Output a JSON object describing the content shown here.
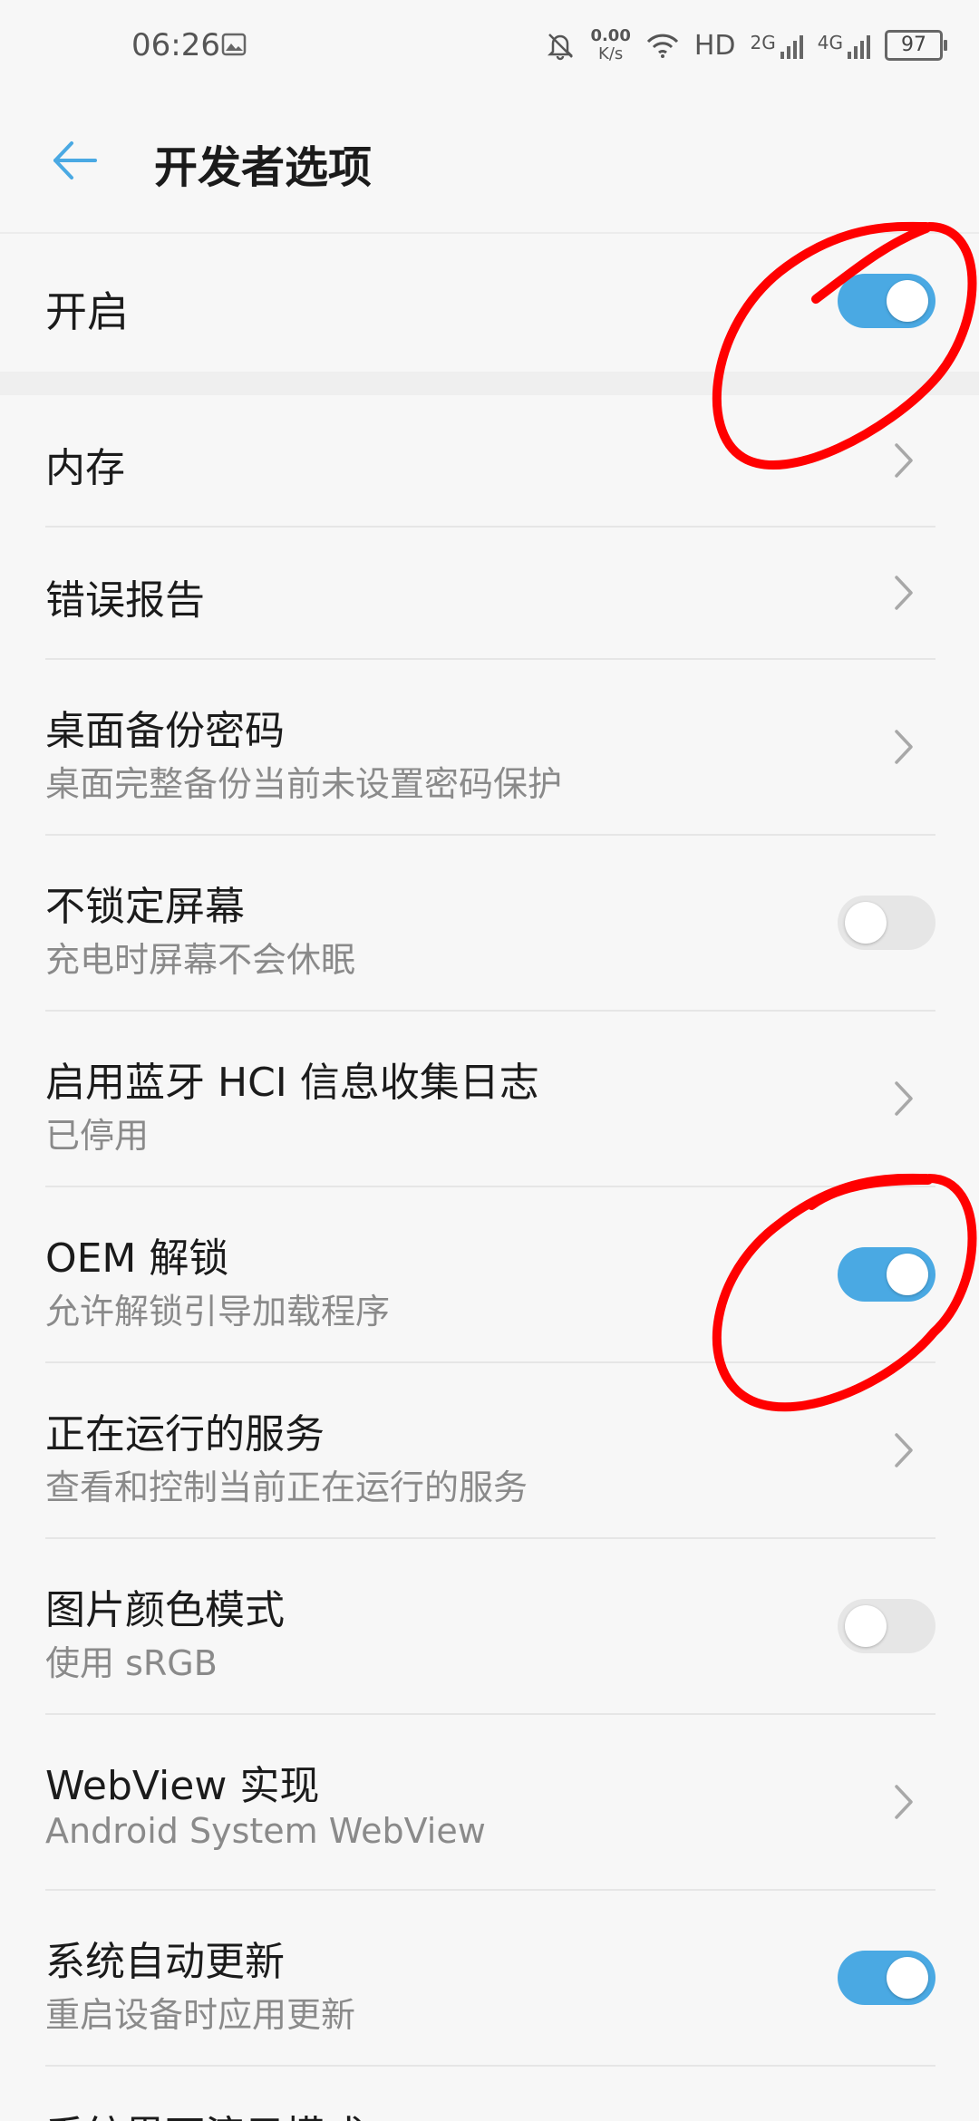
{
  "status_bar": {
    "time": "06:26",
    "net_speed_value": "0.00",
    "net_speed_unit": "K/s",
    "hd_label": "HD",
    "sim1_label": "2G",
    "sim2_label": "4G",
    "battery": "97"
  },
  "header": {
    "title": "开发者选项"
  },
  "master": {
    "label": "开启",
    "enabled": true
  },
  "rows": [
    {
      "title": "内存",
      "subtitle": "",
      "control": "chevron"
    },
    {
      "title": "错误报告",
      "subtitle": "",
      "control": "chevron"
    },
    {
      "title": "桌面备份密码",
      "subtitle": "桌面完整备份当前未设置密码保护",
      "control": "chevron"
    },
    {
      "title": "不锁定屏幕",
      "subtitle": "充电时屏幕不会休眠",
      "control": "toggle",
      "enabled": false
    },
    {
      "title": "启用蓝牙 HCI 信息收集日志",
      "subtitle": "已停用",
      "control": "chevron"
    },
    {
      "title": "OEM 解锁",
      "subtitle": "允许解锁引导加载程序",
      "control": "toggle",
      "enabled": true
    },
    {
      "title": "正在运行的服务",
      "subtitle": "查看和控制当前正在运行的服务",
      "control": "chevron"
    },
    {
      "title": "图片颜色模式",
      "subtitle": "使用 sRGB",
      "control": "toggle",
      "enabled": false
    },
    {
      "title": "WebView 实现",
      "subtitle": "Android System WebView",
      "control": "chevron"
    },
    {
      "title": "系统自动更新",
      "subtitle": "重启设备时应用更新",
      "control": "toggle",
      "enabled": true
    },
    {
      "title": "系统界面演示模式",
      "subtitle": "",
      "control": "chevron"
    }
  ],
  "colors": {
    "accent": "#4aa9e3",
    "annotation": "#ff0000",
    "toggle_off": "#e6e6e6"
  },
  "icons": {
    "back": "arrow-left-icon",
    "chevron": "chevron-right-icon",
    "image": "image-icon",
    "mute": "bell-off-icon",
    "wifi": "wifi-icon"
  }
}
